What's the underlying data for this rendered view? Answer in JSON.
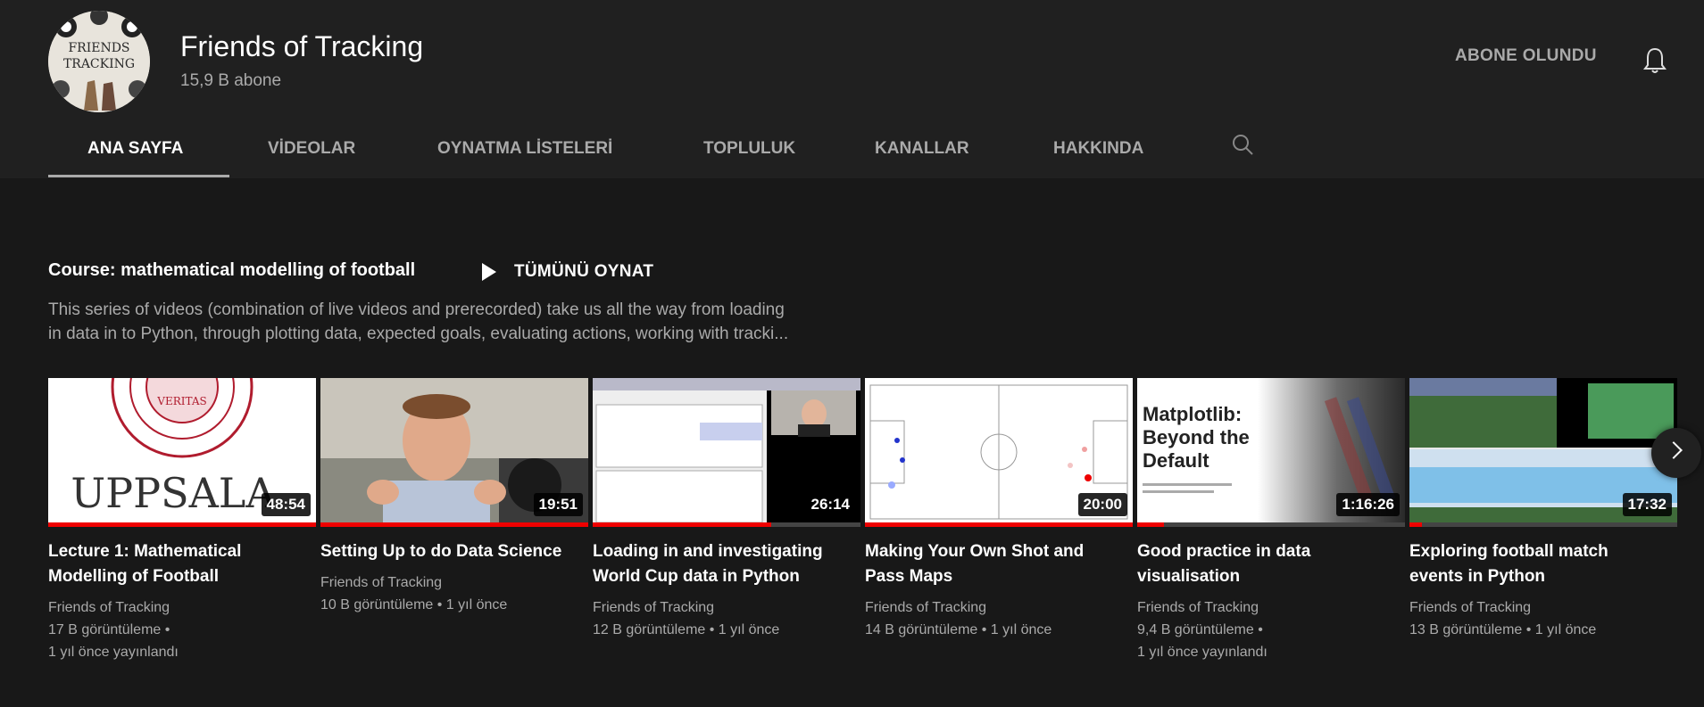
{
  "channel": {
    "name": "Friends of Tracking",
    "subscribers": "15,9 B abone",
    "subscribe_label": "ABONE OLUNDU",
    "avatar_text_line1": "FRIENDS",
    "avatar_text_line2": "TRACKING"
  },
  "tabs": [
    "ANA SAYFA",
    "VİDEOLAR",
    "OYNATMA LİSTELERİ",
    "TOPLULUK",
    "KANALLAR",
    "HAKKINDA"
  ],
  "section": {
    "title": "Course: mathematical modelling of football",
    "play_all": "TÜMÜNÜ OYNAT",
    "description_line1": "This series of videos (combination of live videos and prerecorded) take us all the way from loading",
    "description_line2": "in data in to Python, through plotting data, expected goals, evaluating actions, working with tracki..."
  },
  "videos": [
    {
      "title_line1": "Lecture 1: Mathematical",
      "title_line2": "Modelling of Football",
      "duration": "48:54",
      "channel": "Friends of Tracking",
      "meta_line1": "17 B görüntüleme •",
      "meta_line2": "1 yıl önce yayınlandı",
      "thumb_text": "UPPSALA",
      "progress": 1.0
    },
    {
      "title_line1": "Setting Up to do Data Science",
      "title_line2": "",
      "duration": "19:51",
      "channel": "Friends of Tracking",
      "meta_line1": "10 B görüntüleme • 1 yıl önce",
      "meta_line2": "",
      "progress": 1.0
    },
    {
      "title_line1": "Loading in and investigating",
      "title_line2": "World Cup data in Python",
      "duration": "26:14",
      "channel": "Friends of Tracking",
      "meta_line1": "12 B görüntüleme • 1 yıl önce",
      "meta_line2": "",
      "progress": 0.67
    },
    {
      "title_line1": "Making Your Own Shot and",
      "title_line2": "Pass Maps",
      "duration": "20:00",
      "channel": "Friends of Tracking",
      "meta_line1": "14 B görüntüleme • 1 yıl önce",
      "meta_line2": "",
      "progress": 1.0
    },
    {
      "title_line1": "Good practice in data",
      "title_line2": "visualisation",
      "duration": "1:16:26",
      "channel": "Friends of Tracking",
      "meta_line1": "9,4 B görüntüleme •",
      "meta_line2": "1 yıl önce yayınlandı",
      "thumb_text_1": "Matplotlib:",
      "thumb_text_2": "Beyond the",
      "thumb_text_3": "Default",
      "progress": 0.1
    },
    {
      "title_line1": "Exploring football match",
      "title_line2": "events in Python",
      "duration": "17:32",
      "channel": "Friends of Tracking",
      "meta_line1": "13 B görüntüleme • 1 yıl önce",
      "meta_line2": "",
      "progress": 0.05
    }
  ],
  "colors": {
    "background": "#181818",
    "header": "#202020",
    "progress": "#ee0000",
    "muted": "#aaaaaa"
  }
}
